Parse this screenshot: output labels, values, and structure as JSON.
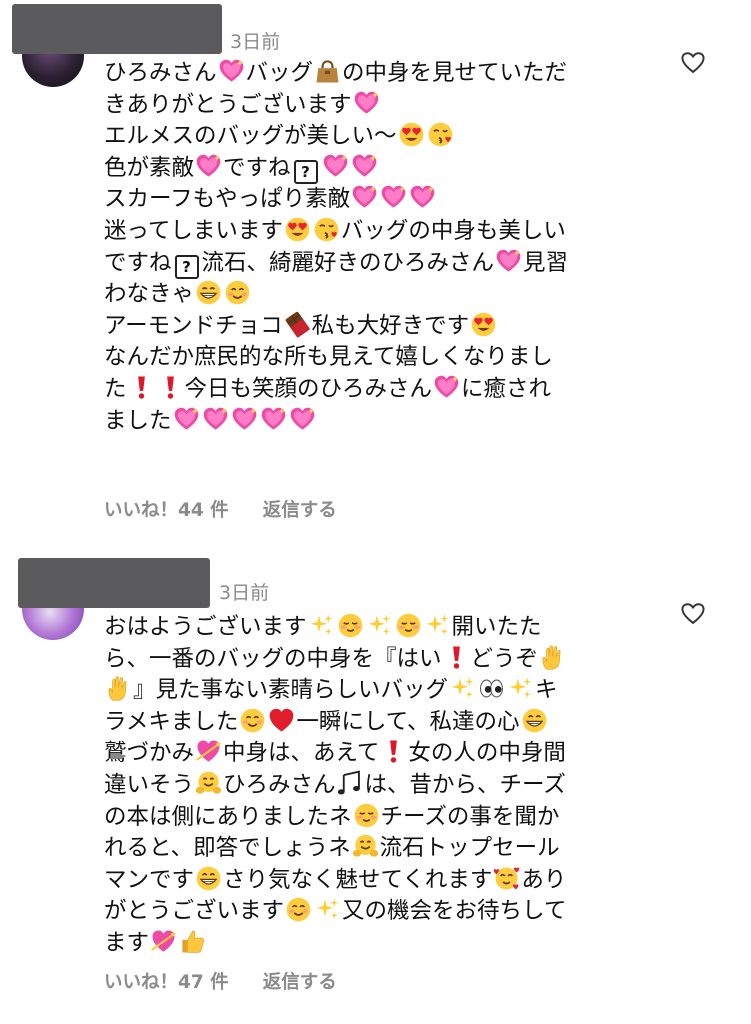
{
  "comments": [
    {
      "time": "3日前",
      "lines": [
        [
          "ひろみさん",
          "{sparkle-heart}",
          "バッグ",
          "{handbag}",
          "の中身を見せていただ"
        ],
        [
          "きありがとうございます",
          "{sparkle-heart}"
        ],
        [
          "エルメスのバッグが美しい〜",
          "{heart-eyes}",
          "{kiss-face}"
        ],
        [
          "色が素敵",
          "{sparkle-heart}",
          "ですね",
          "{?}",
          "{sparkle-heart}",
          "{sparkle-heart}"
        ],
        [
          "スカーフもやっぱり素敵",
          "{sparkle-heart}",
          "{sparkle-heart}",
          "{sparkle-heart}"
        ],
        [
          "迷ってしまいます",
          "{heart-eyes}",
          "{kiss-face}",
          "バッグの中身も美しい"
        ],
        [
          "ですね",
          "{?}",
          "流石、綺麗好きのひろみさん",
          "{sparkle-heart}",
          "見習"
        ],
        [
          "わなきゃ",
          "{grin}",
          "{smile}"
        ],
        [
          "アーモンドチョコ",
          "{chocolate}",
          "私も大好きです",
          "{heart-eyes}"
        ],
        [
          "なんだか庶民的な所も見えて嬉しくなりまし"
        ],
        [
          "た",
          "{exclaim}",
          "{exclaim}",
          "今日も笑顔のひろみさん",
          "{sparkle-heart}",
          "に癒され"
        ],
        [
          "ました",
          "{sparkle-heart}",
          "{sparkle-heart}",
          "{sparkle-heart}",
          "{sparkle-heart}",
          "{sparkle-heart}"
        ]
      ],
      "likes": "いいね！44 件",
      "reply": "返信する"
    },
    {
      "time": "3日前",
      "lines": [
        [
          "おはようございます",
          "{sparkles}",
          "{blush}",
          "{sparkles}",
          "{blush}",
          "{sparkles}",
          "開いたた"
        ],
        [
          "ら、一番のバッグの中身を『はい",
          "{exclaim}",
          "どうぞ",
          "{raised-hand}"
        ],
        [
          "{raised-hand}",
          "』見た事ない素晴らしいバッグ",
          "{sparkles}",
          "{eyes}",
          "{sparkles}",
          "キ"
        ],
        [
          "ラメキました",
          "{smile}",
          "{red-heart}",
          "一瞬にして、私達の心",
          "{grin}"
        ],
        [
          "鷲づかみ",
          "{heart-arrow}",
          "中身は、あえて",
          "{exclaim}",
          "女の人の中身間"
        ],
        [
          "違いそう",
          "{hug}",
          "ひろみさん",
          "{notes}",
          "は、昔から、チーズ"
        ],
        [
          "の本は側にありましたネ",
          "{blush}",
          "チーズの事を聞か"
        ],
        [
          "れると、即答でしょうネ",
          "{hug}",
          "流石トップセール"
        ],
        [
          "マンです",
          "{grin}",
          "さり気なく魅せてくれます",
          "{hearts-face}",
          "あり"
        ],
        [
          "がとうございます",
          "{smile}",
          "{sparkles}",
          "又の機会をお待ちして"
        ],
        [
          "ます",
          "{heart-arrow}",
          "{thumbs-up}"
        ]
      ],
      "likes": "いいね！47 件",
      "reply": "返信する"
    }
  ]
}
